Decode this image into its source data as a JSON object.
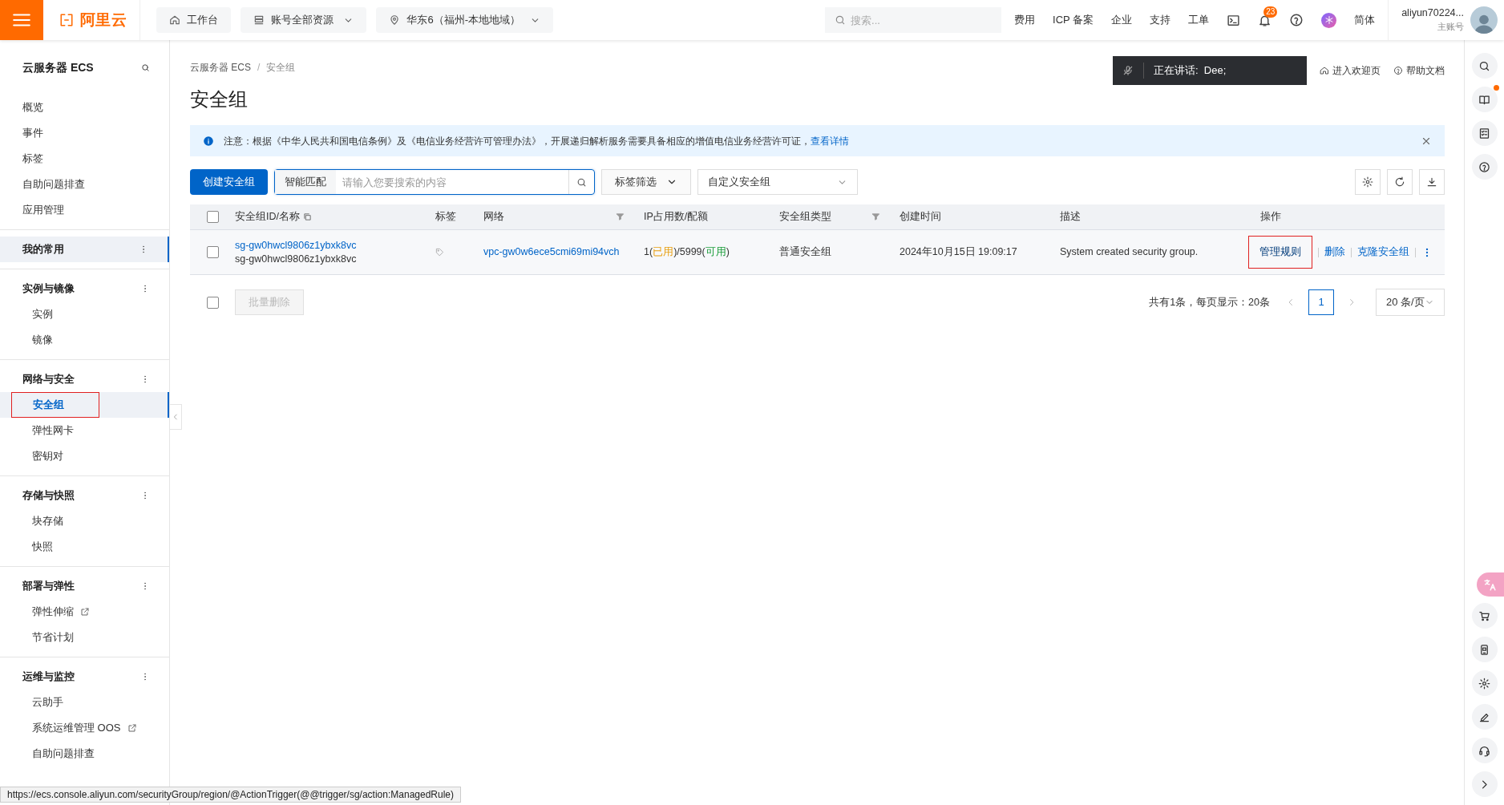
{
  "topbar": {
    "logo": "阿里云",
    "buttons": [
      {
        "kind": "home",
        "label": "工作台",
        "dropdown": false
      },
      {
        "kind": "resources",
        "label": "账号全部资源",
        "dropdown": true
      },
      {
        "kind": "region",
        "label": "华东6（福州-本地地域）",
        "dropdown": true
      }
    ],
    "search": {
      "placeholder": "搜索..."
    },
    "links": [
      "费用",
      "ICP 备案",
      "企业",
      "支持",
      "工单"
    ],
    "notification_count": "23",
    "language": "简体",
    "user": {
      "name": "aliyun70224...",
      "role": "主账号"
    }
  },
  "sidebar": {
    "title": "云服务器 ECS",
    "sections": [
      {
        "items": [
          {
            "label": "概览",
            "selected": false,
            "annotated": false,
            "external": false
          },
          {
            "label": "事件",
            "selected": false,
            "annotated": false,
            "external": false
          },
          {
            "label": "标签",
            "selected": false,
            "annotated": false,
            "external": false
          },
          {
            "label": "自助问题排查",
            "selected": false,
            "annotated": false,
            "external": false
          },
          {
            "label": "应用管理",
            "selected": false,
            "annotated": false,
            "external": false
          }
        ]
      },
      {
        "heading": "我的常用",
        "highlighted": true
      },
      {
        "heading": "实例与镜像",
        "highlighted": false,
        "items": [
          {
            "label": "实例",
            "selected": false,
            "annotated": false,
            "external": false
          },
          {
            "label": "镜像",
            "selected": false,
            "annotated": false,
            "external": false
          }
        ]
      },
      {
        "heading": "网络与安全",
        "highlighted": false,
        "items": [
          {
            "label": "安全组",
            "selected": true,
            "annotated": true,
            "external": false
          },
          {
            "label": "弹性网卡",
            "selected": false,
            "annotated": false,
            "external": false
          },
          {
            "label": "密钥对",
            "selected": false,
            "annotated": false,
            "external": false
          }
        ]
      },
      {
        "heading": "存储与快照",
        "highlighted": false,
        "items": [
          {
            "label": "块存储",
            "selected": false,
            "annotated": false,
            "external": false
          },
          {
            "label": "快照",
            "selected": false,
            "annotated": false,
            "external": false
          }
        ]
      },
      {
        "heading": "部署与弹性",
        "highlighted": false,
        "items": [
          {
            "label": "弹性伸缩",
            "selected": false,
            "annotated": false,
            "external": true
          },
          {
            "label": "节省计划",
            "selected": false,
            "annotated": false,
            "external": false
          }
        ]
      },
      {
        "heading": "运维与监控",
        "highlighted": false,
        "items": [
          {
            "label": "云助手",
            "selected": false,
            "annotated": false,
            "external": false
          },
          {
            "label": "系统运维管理 OOS",
            "selected": false,
            "annotated": false,
            "external": true
          },
          {
            "label": "自助问题排查",
            "selected": false,
            "annotated": false,
            "external": false
          }
        ]
      }
    ]
  },
  "breadcrumb": {
    "items": [
      "云服务器 ECS",
      "安全组"
    ],
    "separator": "/"
  },
  "speaking_banner": "正在讲话:  Dee;",
  "header_links": [
    {
      "kind": "home",
      "label": "进入欢迎页"
    },
    {
      "kind": "help",
      "label": "帮助文档"
    }
  ],
  "page_title": "安全组",
  "notice": {
    "text": "注意：根据《中华人民共和国电信条例》及《电信业务经营许可管理办法》，开展递归解析服务需要具备相应的增值电信业务经营许可证，",
    "link": "查看详情"
  },
  "toolbar": {
    "create_button": "创建安全组",
    "search_mode": "智能匹配",
    "search_placeholder": "请输入您要搜索的内容",
    "tag_filter": "标签筛选",
    "group_filter": "自定义安全组"
  },
  "table": {
    "select_all_checked": false,
    "columns": [
      {
        "label": "安全组ID/名称",
        "filter": false,
        "copy": true
      },
      {
        "label": "标签",
        "filter": false,
        "copy": false
      },
      {
        "label": "网络",
        "filter": true,
        "copy": false
      },
      {
        "label": "IP占用数/配额",
        "filter": false,
        "copy": false
      },
      {
        "label": "安全组类型",
        "filter": true,
        "copy": false
      },
      {
        "label": "创建时间",
        "filter": false,
        "copy": false
      },
      {
        "label": "描述",
        "filter": false,
        "copy": false
      },
      {
        "label": "操作",
        "filter": false,
        "copy": false
      }
    ],
    "rows": [
      {
        "checked": false,
        "id": "sg-gw0hwcl9806z1ybxk8vc",
        "name": "sg-gw0hwcl9806z1ybxk8vc",
        "network": "vpc-gw0w6ece5cmi69mi94vch",
        "ip_usage": [
          {
            "kind": "plain",
            "text": "1("
          },
          {
            "kind": "used",
            "text": "已用"
          },
          {
            "kind": "plain",
            "text": ")/5999("
          },
          {
            "kind": "available",
            "text": "可用"
          },
          {
            "kind": "plain",
            "text": ")"
          }
        ],
        "type": "普通安全组",
        "created": "2024年10月15日 19:09:17",
        "description": "System created security group.",
        "actions": [
          {
            "label": "管理规则",
            "annotated": true
          },
          {
            "label": "删除",
            "annotated": false
          },
          {
            "label": "克隆安全组",
            "annotated": false
          }
        ]
      }
    ]
  },
  "footer": {
    "select_all_checked": false,
    "bulk_delete": "批量删除",
    "bulk_delete_disabled": true,
    "summary": "共有1条，每页显示：20条",
    "pages": [
      {
        "label": "1",
        "selected": true
      }
    ],
    "page_size": "20 条/页"
  },
  "status_url": "https://ecs.console.aliyun.com/securityGroup/region/@ActionTrigger(@@trigger/sg/action:ManagedRule)"
}
